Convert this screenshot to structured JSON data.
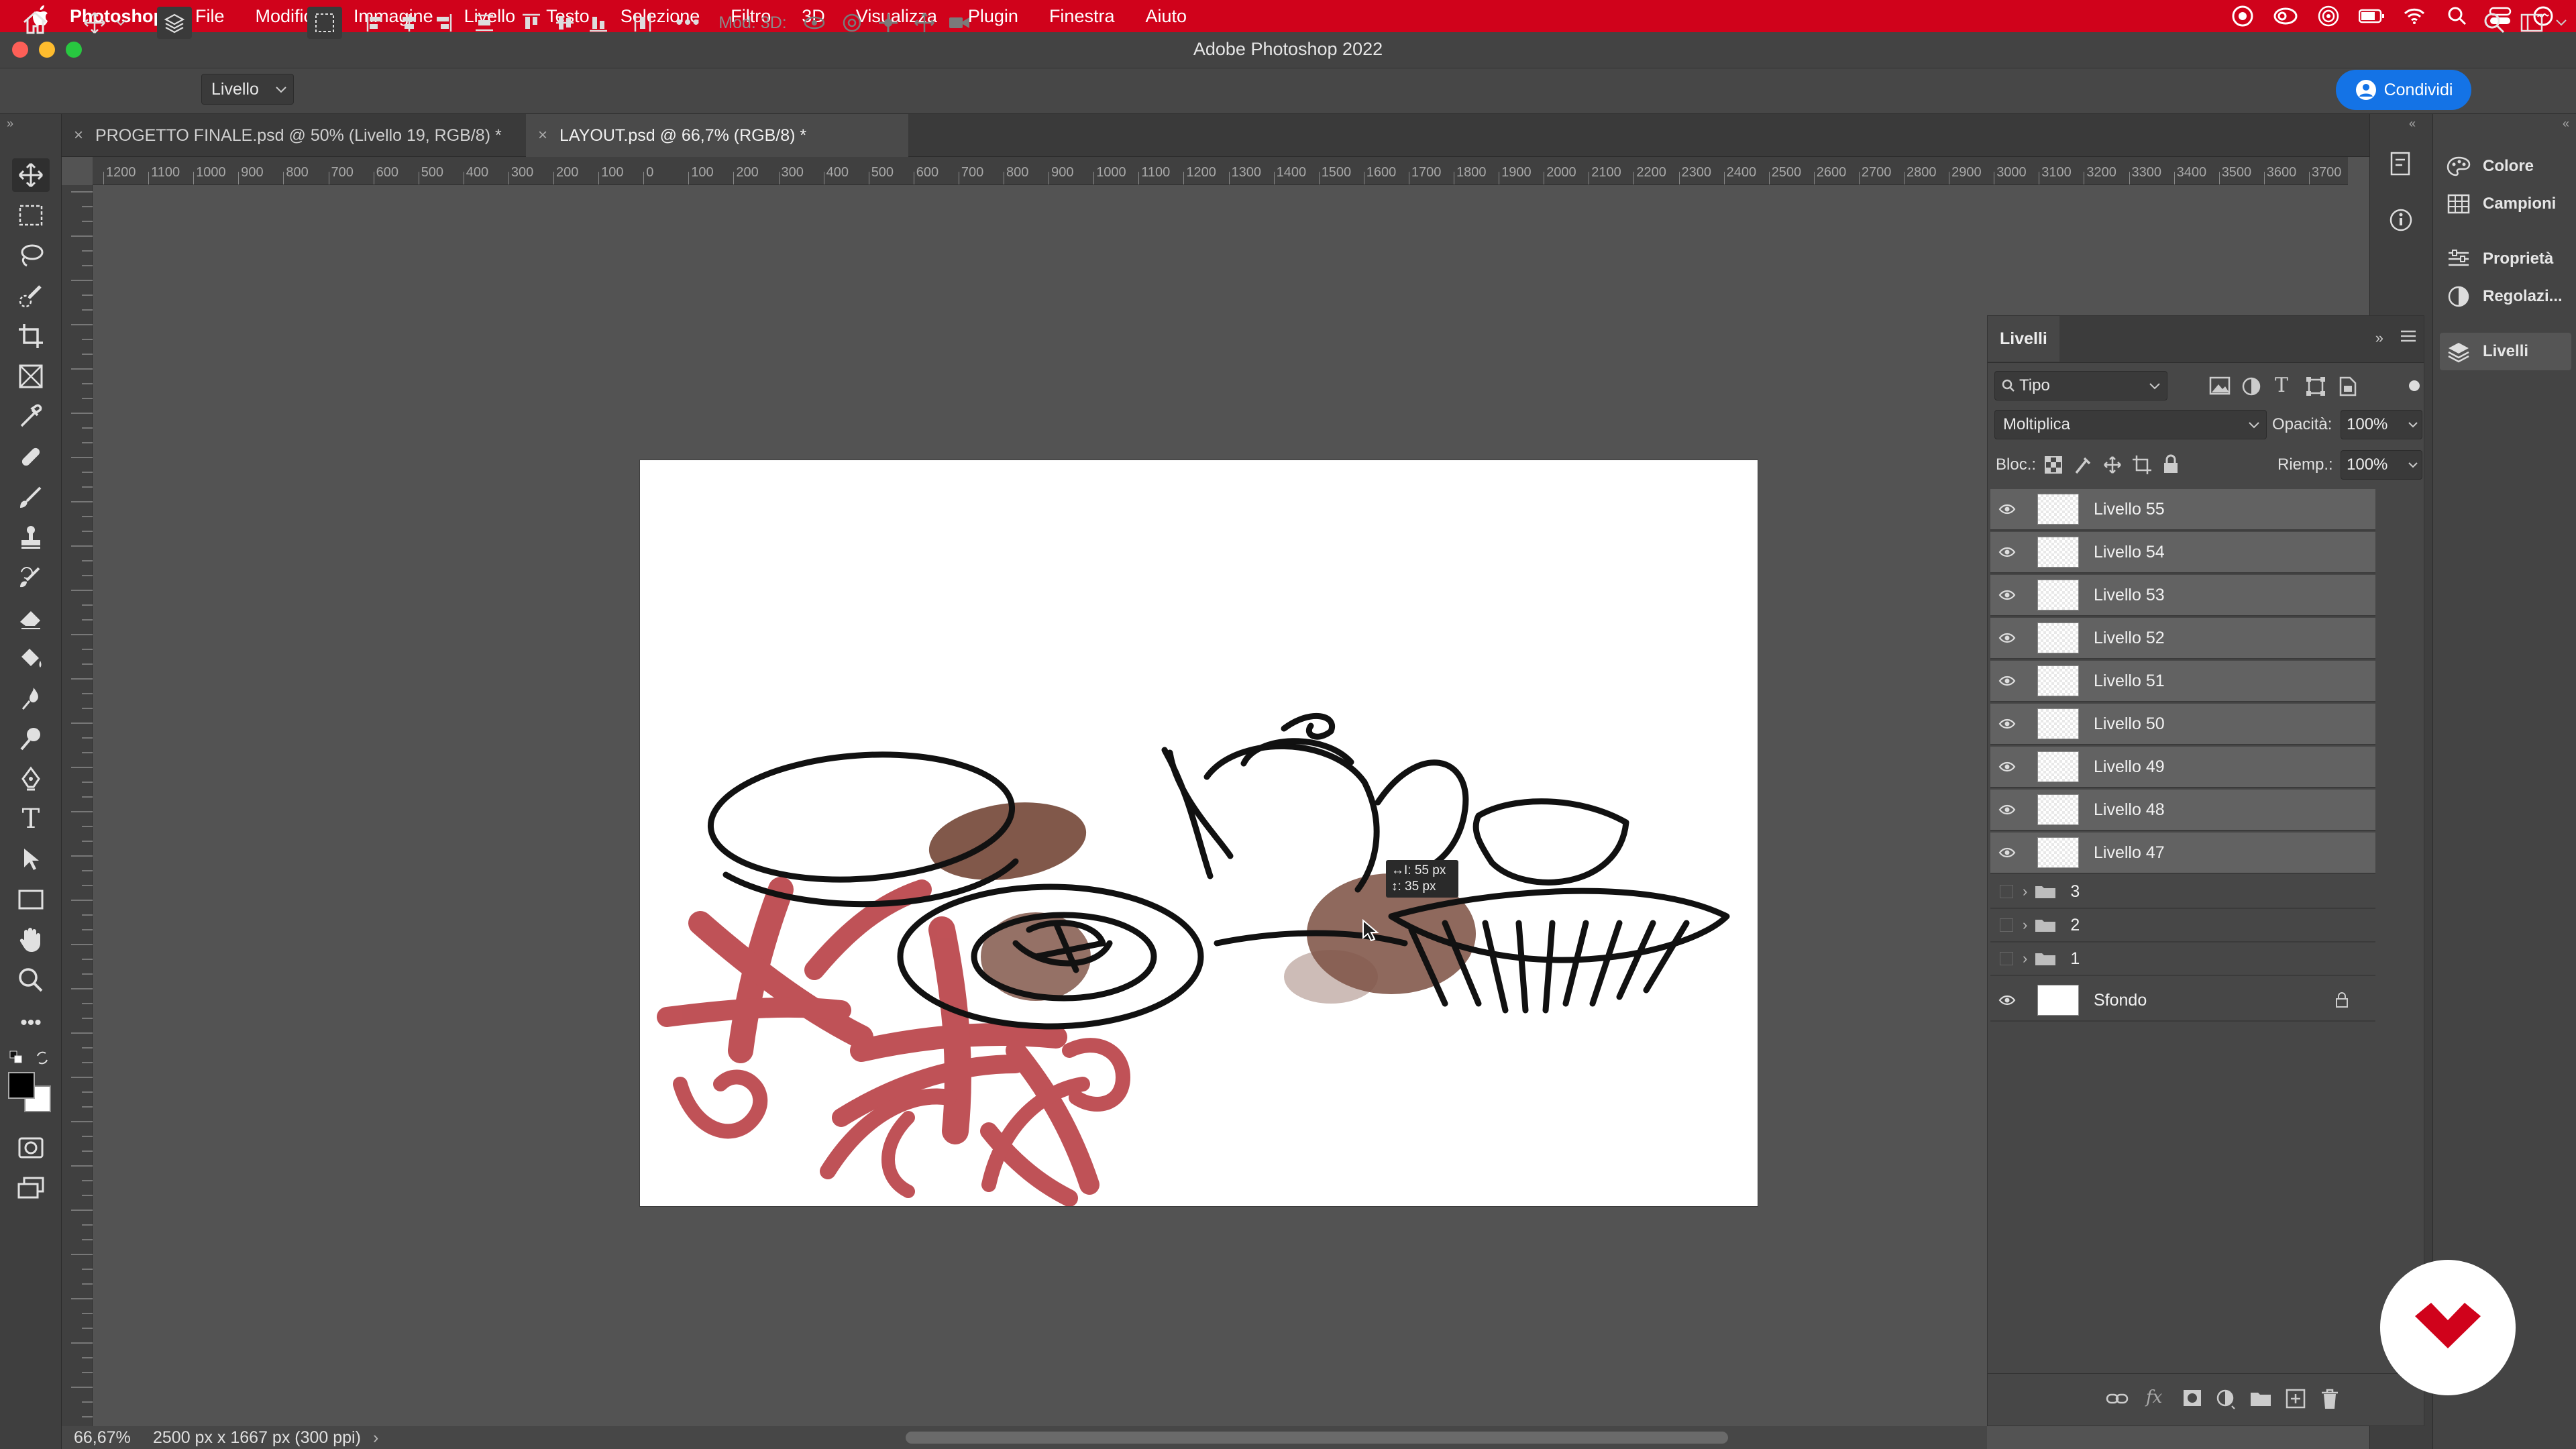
{
  "menubar": {
    "app": "Photoshop",
    "items": [
      "File",
      "Modifica",
      "Immagine",
      "Livello",
      "Testo",
      "Selezione",
      "Filtro",
      "3D",
      "Visualizza",
      "Plugin",
      "Finestra",
      "Aiuto"
    ]
  },
  "window": {
    "title": "Adobe Photoshop 2022"
  },
  "options": {
    "select_value": "Livello",
    "mode3d": "Mod. 3D:",
    "share": "Condividi"
  },
  "tabs": [
    {
      "label": "PROGETTO FINALE.psd @ 50% (Livello 19, RGB/8) *"
    },
    {
      "label": "LAYOUT.psd @ 66,7% (RGB/8) *"
    }
  ],
  "ruler": {
    "labels": [
      "1200",
      "1100",
      "1000",
      "900",
      "800",
      "700",
      "600",
      "500",
      "400",
      "300",
      "200",
      "100",
      "0",
      "100",
      "200",
      "300",
      "400",
      "500",
      "600",
      "700",
      "800",
      "900",
      "1000",
      "1100",
      "1200",
      "1300",
      "1400",
      "1500",
      "1600",
      "1700",
      "1800",
      "1900",
      "2000",
      "2100",
      "2200",
      "2300",
      "2400",
      "2500",
      "2600",
      "2700",
      "2800",
      "2900",
      "3000",
      "3100",
      "3200",
      "3300",
      "3400",
      "3500",
      "3600",
      "3700"
    ]
  },
  "tooltip": {
    "line1": "↔I: 55 px",
    "line2": "↕: 35 px"
  },
  "status": {
    "zoom": "66,67%",
    "info": "2500 px x 1667 px (300 ppi)"
  },
  "dock": {
    "items": [
      "Colore",
      "Campioni",
      "Proprietà",
      "Regolazi...",
      "Livelli"
    ]
  },
  "layers": {
    "title": "Livelli",
    "filter": "Tipo",
    "blend": "Moltiplica",
    "opacity_label": "Opacità:",
    "opacity": "100%",
    "lock_label": "Bloc.:",
    "fill_label": "Riemp.:",
    "fill": "100%",
    "items": [
      {
        "name": "Livello 55"
      },
      {
        "name": "Livello 54"
      },
      {
        "name": "Livello 53"
      },
      {
        "name": "Livello 52"
      },
      {
        "name": "Livello 51"
      },
      {
        "name": "Livello 50"
      },
      {
        "name": "Livello 49"
      },
      {
        "name": "Livello 48"
      },
      {
        "name": "Livello 47"
      }
    ],
    "groups": [
      {
        "name": "3"
      },
      {
        "name": "2"
      },
      {
        "name": "1"
      }
    ],
    "background": {
      "name": "Sfondo"
    }
  },
  "colors": {
    "menubar": "#d0021b",
    "accent": "#1473e6",
    "ink": "#111111",
    "red_wash": "#b5343a",
    "brown_wash": "#6b3a2a"
  }
}
